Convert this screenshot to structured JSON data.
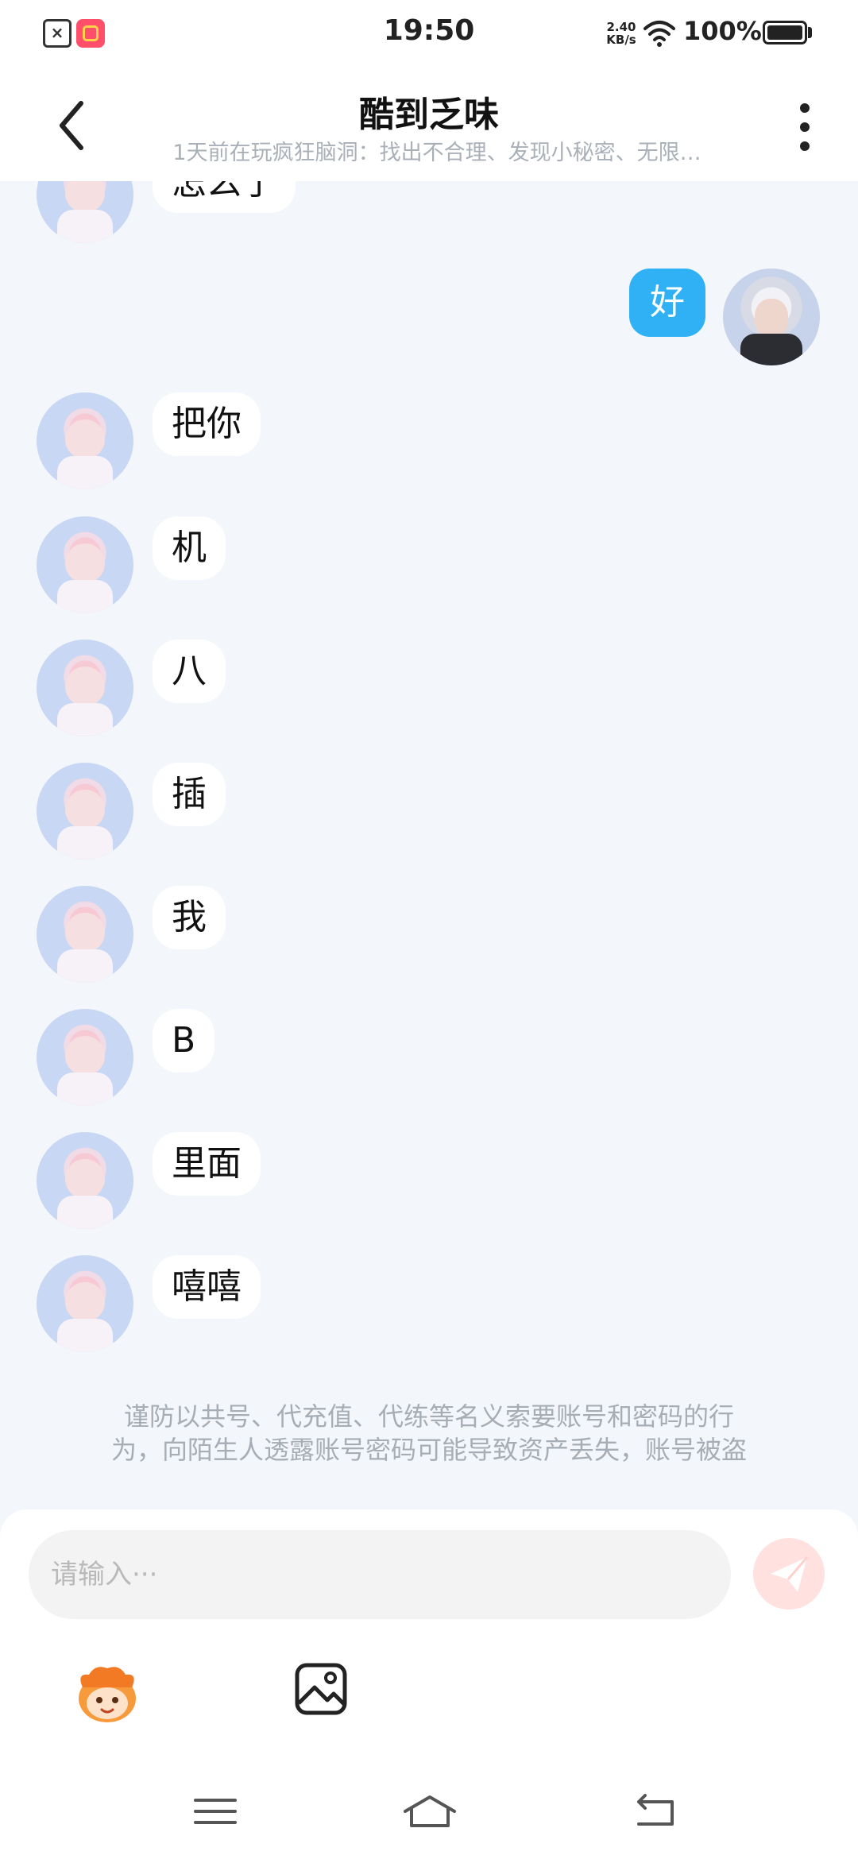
{
  "status_bar": {
    "time": "19:50",
    "net_speed_value": "2.40",
    "net_speed_unit": "KB/s",
    "battery": "100%"
  },
  "header": {
    "title": "酷到乏味",
    "subtitle": "1天前在玩疯狂脑洞：找出不合理、发现小秘密、无限…"
  },
  "messages": {
    "partial": "怎么了",
    "self_1": "好",
    "m1": "把你",
    "m2": "机",
    "m3": "八",
    "m4": "插",
    "m5": "我",
    "m6": "B",
    "m7": "里面",
    "m8": "嘻嘻"
  },
  "notice": {
    "line1": "谨防以共号、代充值、代练等名义索要账号和密码的行",
    "line2": "为，向陌生人透露账号密码可能导致资产丢失，账号被盗"
  },
  "input": {
    "placeholder": "请输入···"
  },
  "colors": {
    "accent": "#31b1f5",
    "send_button": "#ffe1df",
    "background": "#f3f6fa"
  },
  "icons": {
    "back": "back-arrow-icon",
    "more": "more-vertical-icon",
    "send": "send-icon",
    "emoji": "emoji-avatar-icon",
    "image": "image-icon",
    "nav_menu": "menu-icon",
    "nav_home": "home-icon",
    "nav_back": "nav-back-icon"
  }
}
